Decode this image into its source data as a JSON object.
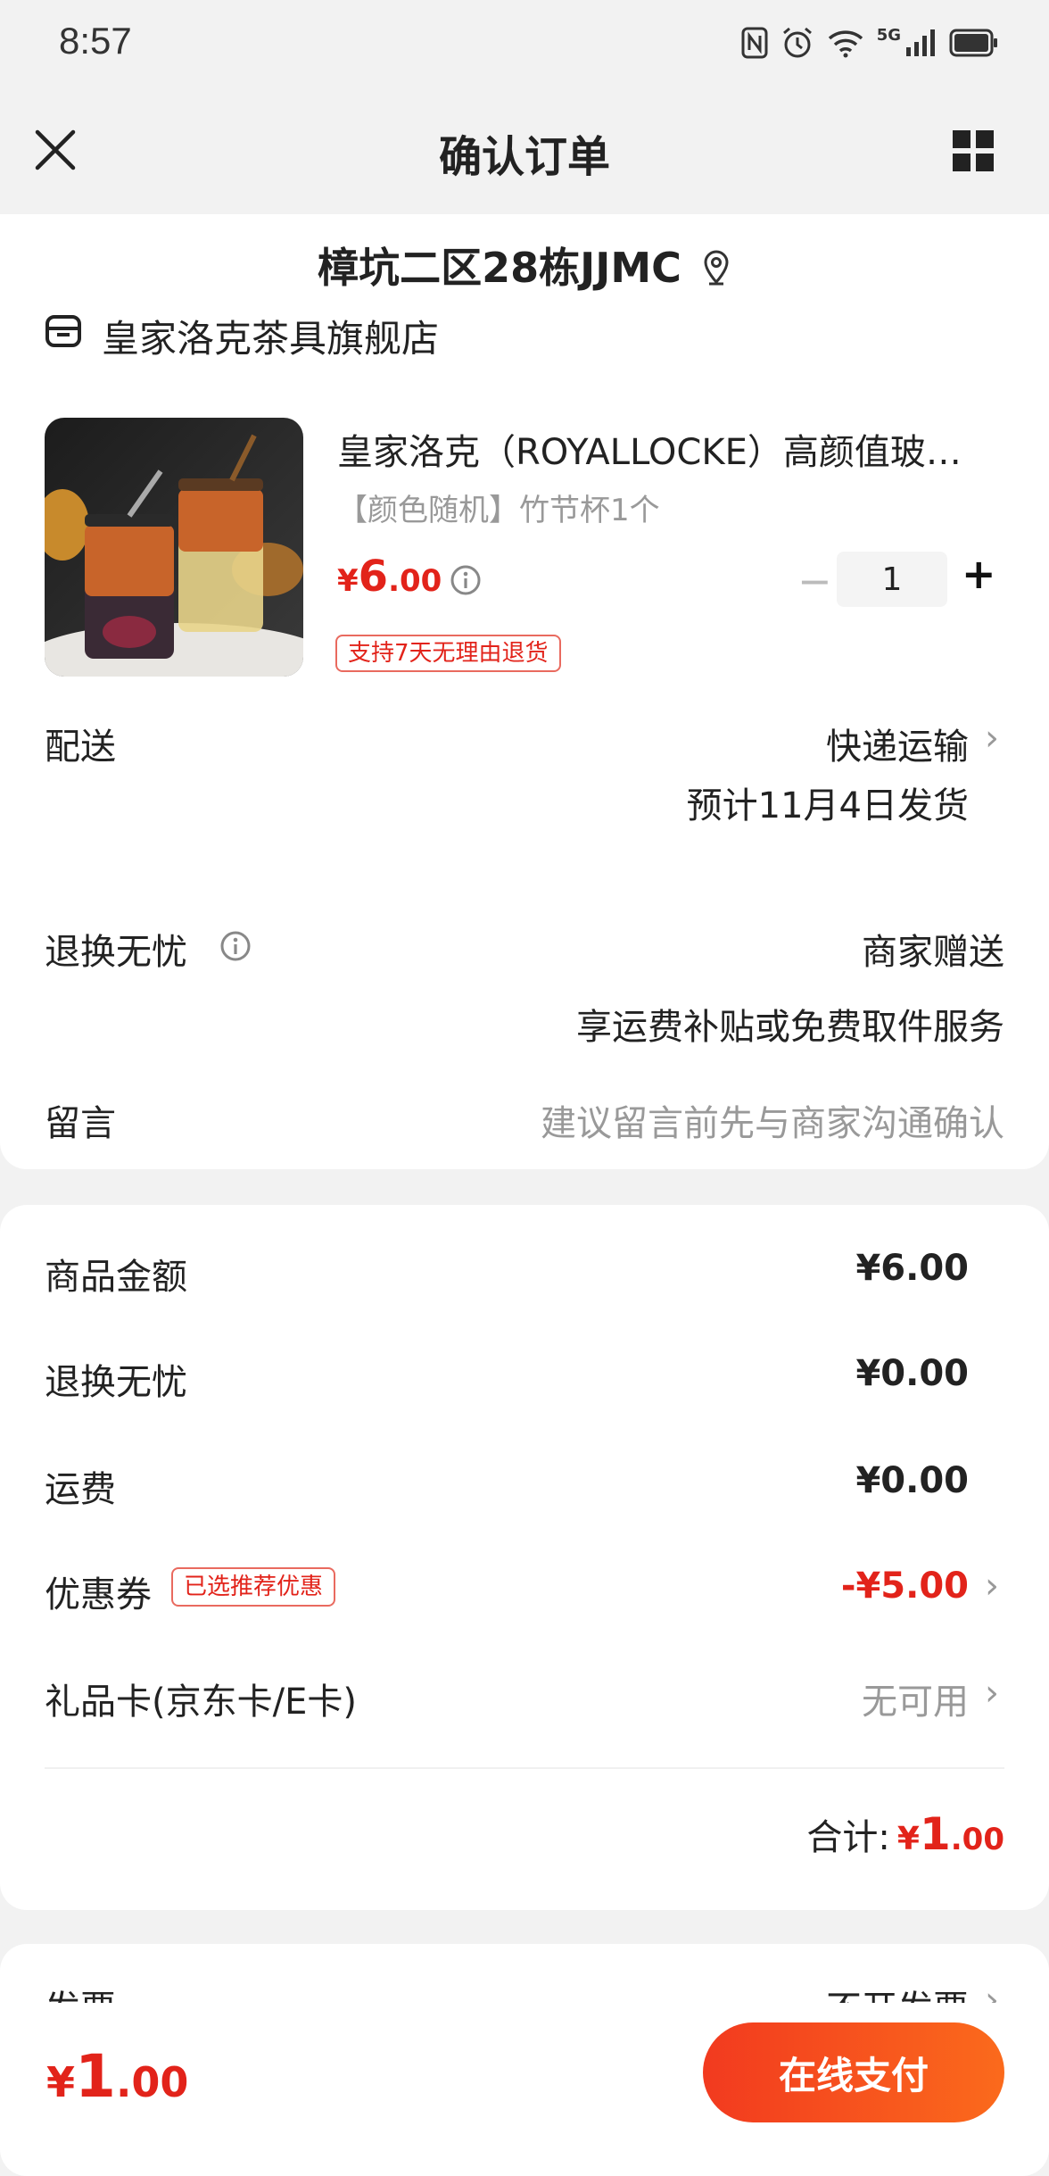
{
  "status_bar": {
    "time": "8:57",
    "network": "5G"
  },
  "nav": {
    "title": "确认订单"
  },
  "address": {
    "text": "樟坑二区28栋JJMC"
  },
  "shop": {
    "name": "皇家洛克茶具旗舰店"
  },
  "product": {
    "title": "皇家洛克（ROYALLOCKE）高颜值玻…",
    "spec": "【颜色随机】竹节杯1个",
    "price_currency": "¥",
    "price_integer": "6",
    "price_decimal": ".00",
    "minus": "−",
    "quantity": "1",
    "plus": "+",
    "return_badge": "支持7天无理由退货"
  },
  "delivery": {
    "label": "配送",
    "method": "快递运输",
    "estimate": "预计11月4日发货"
  },
  "worry_free": {
    "label": "退换无忧",
    "value": "商家赠送",
    "sub": "享运费补贴或免费取件服务"
  },
  "message": {
    "label": "留言",
    "placeholder": "建议留言前先与商家沟通确认"
  },
  "summary": {
    "goods_label": "商品金额",
    "goods_value": "¥6.00",
    "worry_label": "退换无忧",
    "worry_value": "¥0.00",
    "shipping_label": "运费",
    "shipping_value": "¥0.00",
    "coupon_label": "优惠券",
    "coupon_badge": "已选推荐优惠",
    "coupon_value": "-¥5.00",
    "giftcard_label": "礼品卡(京东卡/E卡)",
    "giftcard_value": "无可用",
    "total_label": "合计:",
    "total_currency": "¥",
    "total_integer": "1",
    "total_decimal": ".00"
  },
  "invoice": {
    "label": "发票",
    "value": "不开发票"
  },
  "bottom": {
    "currency": "¥",
    "integer": "1",
    "decimal": ".00",
    "pay_label": "在线支付"
  },
  "colors": {
    "accent": "#e2231a",
    "pay_gradient_start": "#f23a1f",
    "pay_gradient_end": "#fb6a1c"
  }
}
